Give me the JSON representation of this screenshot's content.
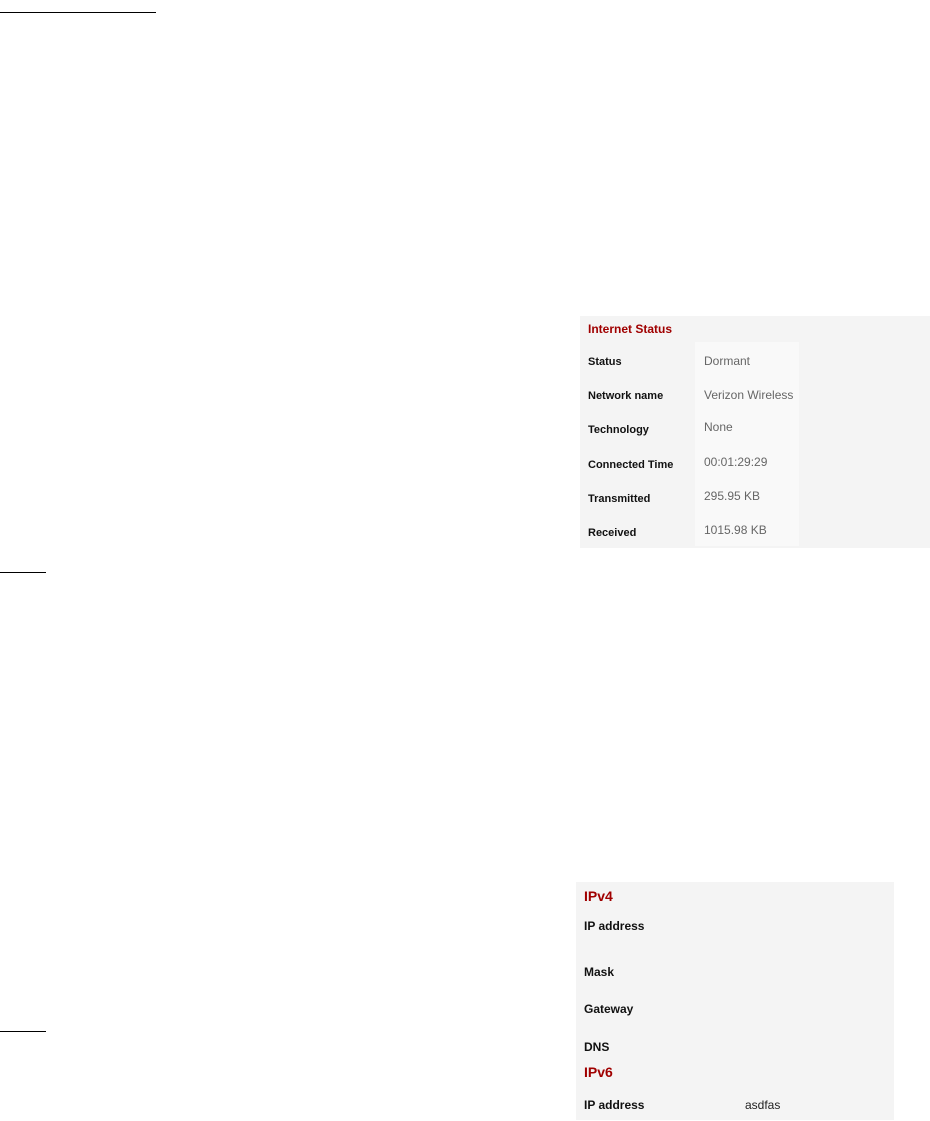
{
  "internet_status": {
    "title": "Internet Status",
    "rows": [
      {
        "label": "Status",
        "value": "Dormant"
      },
      {
        "label": "Network name",
        "value": "Verizon Wireless"
      },
      {
        "label": "Technology",
        "value": "None"
      },
      {
        "label": "Connected Time",
        "value": "00:01:29:29"
      },
      {
        "label": "Transmitted",
        "value": "295.95 KB"
      },
      {
        "label": "Received",
        "value": "1015.98 KB"
      }
    ]
  },
  "ip": {
    "ipv4": {
      "title": "IPv4",
      "rows": [
        {
          "label": "IP address",
          "value": ""
        },
        {
          "label": "Mask",
          "value": ""
        },
        {
          "label": "Gateway",
          "value": ""
        },
        {
          "label": "DNS",
          "value": ""
        }
      ]
    },
    "ipv6": {
      "title": "IPv6",
      "rows": [
        {
          "label": "IP address",
          "value": "asdfas"
        }
      ]
    }
  },
  "colors": {
    "section_title": "#a00000",
    "panel_bg": "#f4f4f4"
  }
}
